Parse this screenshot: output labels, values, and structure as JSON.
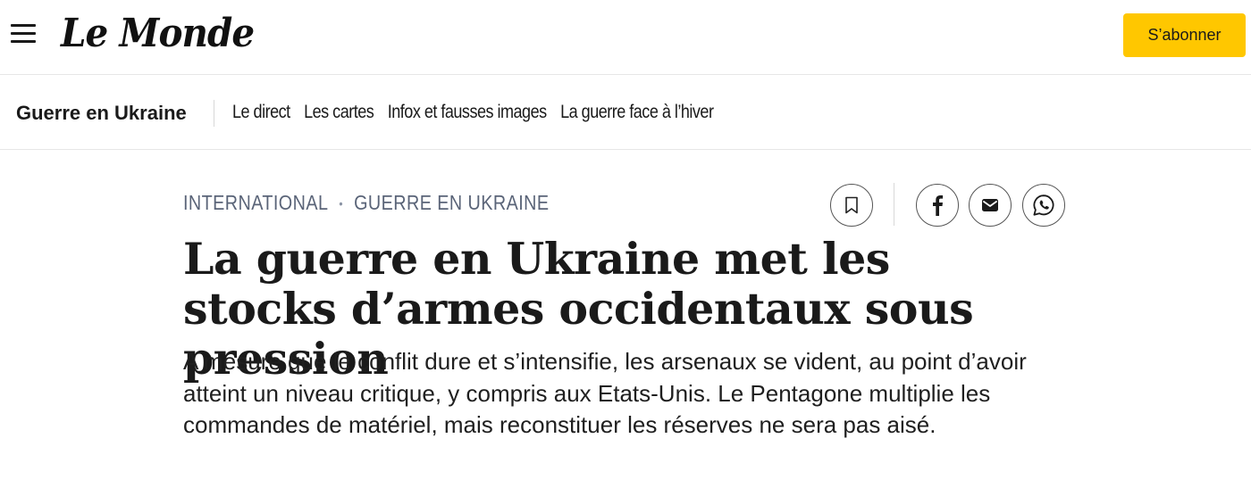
{
  "header": {
    "logo_text": "Le Monde",
    "subscribe_label": "S’abonner",
    "menu_icon": "hamburger-icon",
    "accent_color": "#ffc700"
  },
  "section_nav": {
    "title": "Guerre en Ukraine",
    "links": [
      {
        "label": "Le direct"
      },
      {
        "label": "Les cartes"
      },
      {
        "label": "Infox et fausses images"
      },
      {
        "label": "La guerre face à l’hiver"
      }
    ]
  },
  "article": {
    "kicker": {
      "category": "INTERNATIONAL",
      "separator": "•",
      "subcategory": "GUERRE EN UKRAINE"
    },
    "headline": "La guerre en Ukraine met les stocks d’armes occidentaux sous pression",
    "lede": "A mesure que le conflit dure et s’intensifie, les arsenaux se vident, au point d’avoir atteint un niveau critique, y compris aux Etats-Unis. Le Pentagone multiplie les commandes de matériel, mais reconstituer les réserves ne sera pas aisé."
  },
  "share": {
    "icons": [
      "bookmark-icon",
      "facebook-icon",
      "email-icon",
      "whatsapp-icon"
    ]
  }
}
